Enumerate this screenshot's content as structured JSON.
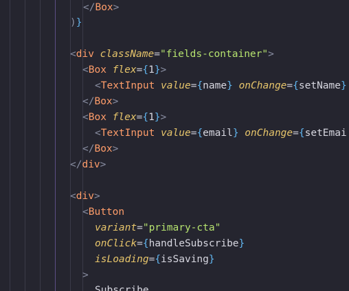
{
  "editor": {
    "lines": [
      [
        {
          "t": "</",
          "c": "punct"
        },
        {
          "t": "Box",
          "c": "tag"
        },
        {
          "t": ">",
          "c": "punct"
        }
      ],
      [
        {
          "t": ")",
          "c": "punct"
        },
        {
          "t": "}",
          "c": "brace"
        }
      ],
      [],
      [
        {
          "t": "<",
          "c": "punct"
        },
        {
          "t": "div",
          "c": "tag"
        },
        {
          "t": " ",
          "c": "text"
        },
        {
          "t": "className",
          "c": "attr"
        },
        {
          "t": "=",
          "c": "eq"
        },
        {
          "t": "\"fields-container\"",
          "c": "string"
        },
        {
          "t": ">",
          "c": "punct"
        }
      ],
      [
        {
          "t": "<",
          "c": "punct"
        },
        {
          "t": "Box",
          "c": "tag"
        },
        {
          "t": " ",
          "c": "text"
        },
        {
          "t": "flex",
          "c": "attr"
        },
        {
          "t": "=",
          "c": "eq"
        },
        {
          "t": "{",
          "c": "brace"
        },
        {
          "t": "1",
          "c": "var"
        },
        {
          "t": "}",
          "c": "brace"
        },
        {
          "t": ">",
          "c": "punct"
        }
      ],
      [
        {
          "t": "<",
          "c": "punct"
        },
        {
          "t": "TextInput",
          "c": "tag"
        },
        {
          "t": " ",
          "c": "text"
        },
        {
          "t": "value",
          "c": "attr"
        },
        {
          "t": "=",
          "c": "eq"
        },
        {
          "t": "{",
          "c": "brace"
        },
        {
          "t": "name",
          "c": "var"
        },
        {
          "t": "}",
          "c": "brace"
        },
        {
          "t": " ",
          "c": "text"
        },
        {
          "t": "onChange",
          "c": "attr"
        },
        {
          "t": "=",
          "c": "eq"
        },
        {
          "t": "{",
          "c": "brace"
        },
        {
          "t": "setName",
          "c": "var"
        },
        {
          "t": "}",
          "c": "brace"
        }
      ],
      [
        {
          "t": "</",
          "c": "punct"
        },
        {
          "t": "Box",
          "c": "tag"
        },
        {
          "t": ">",
          "c": "punct"
        }
      ],
      [
        {
          "t": "<",
          "c": "punct"
        },
        {
          "t": "Box",
          "c": "tag"
        },
        {
          "t": " ",
          "c": "text"
        },
        {
          "t": "flex",
          "c": "attr"
        },
        {
          "t": "=",
          "c": "eq"
        },
        {
          "t": "{",
          "c": "brace"
        },
        {
          "t": "1",
          "c": "var"
        },
        {
          "t": "}",
          "c": "brace"
        },
        {
          "t": ">",
          "c": "punct"
        }
      ],
      [
        {
          "t": "<",
          "c": "punct"
        },
        {
          "t": "TextInput",
          "c": "tag"
        },
        {
          "t": " ",
          "c": "text"
        },
        {
          "t": "value",
          "c": "attr"
        },
        {
          "t": "=",
          "c": "eq"
        },
        {
          "t": "{",
          "c": "brace"
        },
        {
          "t": "email",
          "c": "var"
        },
        {
          "t": "}",
          "c": "brace"
        },
        {
          "t": " ",
          "c": "text"
        },
        {
          "t": "onChange",
          "c": "attr"
        },
        {
          "t": "=",
          "c": "eq"
        },
        {
          "t": "{",
          "c": "brace"
        },
        {
          "t": "setEmai",
          "c": "var"
        }
      ],
      [
        {
          "t": "</",
          "c": "punct"
        },
        {
          "t": "Box",
          "c": "tag"
        },
        {
          "t": ">",
          "c": "punct"
        }
      ],
      [
        {
          "t": "</",
          "c": "punct"
        },
        {
          "t": "div",
          "c": "tag"
        },
        {
          "t": ">",
          "c": "punct"
        }
      ],
      [],
      [
        {
          "t": "<",
          "c": "punct"
        },
        {
          "t": "div",
          "c": "tag"
        },
        {
          "t": ">",
          "c": "punct"
        }
      ],
      [
        {
          "t": "<",
          "c": "punct"
        },
        {
          "t": "Button",
          "c": "tag"
        }
      ],
      [
        {
          "t": "variant",
          "c": "attr"
        },
        {
          "t": "=",
          "c": "eq"
        },
        {
          "t": "\"primary-cta\"",
          "c": "string"
        }
      ],
      [
        {
          "t": "onClick",
          "c": "attr"
        },
        {
          "t": "=",
          "c": "eq"
        },
        {
          "t": "{",
          "c": "brace"
        },
        {
          "t": "handleSubscribe",
          "c": "var"
        },
        {
          "t": "}",
          "c": "brace"
        }
      ],
      [
        {
          "t": "isLoading",
          "c": "attr"
        },
        {
          "t": "=",
          "c": "eq"
        },
        {
          "t": "{",
          "c": "brace"
        },
        {
          "t": "isSaving",
          "c": "var"
        },
        {
          "t": "}",
          "c": "brace"
        }
      ],
      [
        {
          "t": ">",
          "c": "punct"
        }
      ],
      [
        {
          "t": "Subscribe",
          "c": "text"
        }
      ]
    ]
  },
  "theme": {
    "background": "#25252f",
    "tag": "#ff9d6a",
    "attribute": "#e7c56b",
    "string": "#b6e36f",
    "brace": "#61b6f0",
    "punctuation": "#8a8fa3",
    "text": "#d7d7e0"
  }
}
